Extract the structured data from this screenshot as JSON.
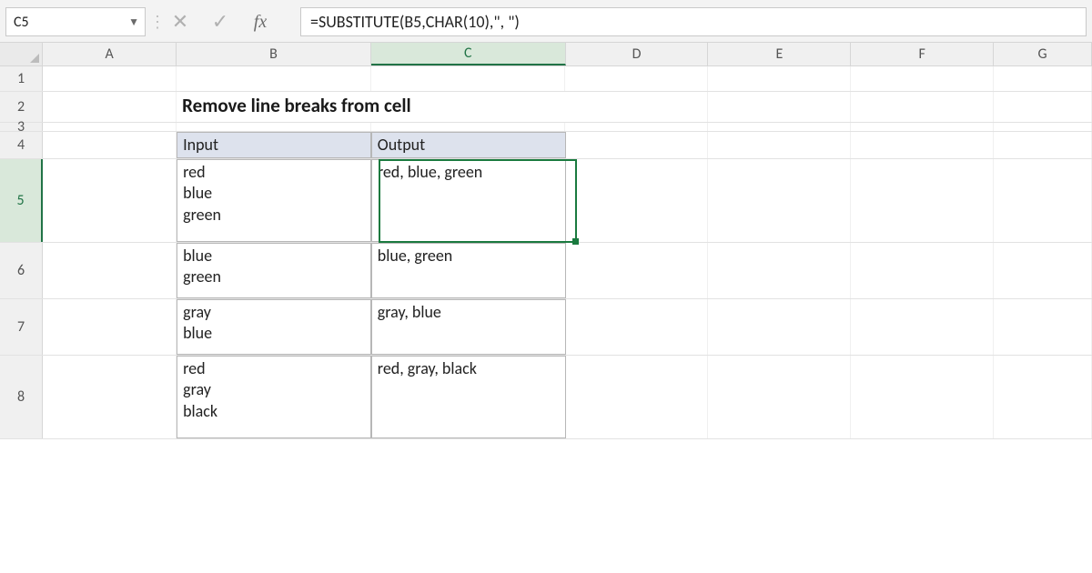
{
  "namebox": {
    "value": "C5"
  },
  "formula": "=SUBSTITUTE(B5,CHAR(10),\", \")",
  "fx_label": "fx",
  "columns": {
    "A": "A",
    "B": "B",
    "C": "C",
    "D": "D",
    "E": "E",
    "F": "F",
    "G": "G"
  },
  "rows": {
    "r1": "1",
    "r2": "2",
    "r3": "3",
    "r4": "4",
    "r5": "5",
    "r6": "6",
    "r7": "7",
    "r8": "8"
  },
  "title": "Remove line breaks from cell",
  "headers": {
    "input": "Input",
    "output": "Output"
  },
  "data": [
    {
      "input": "red\nblue\ngreen",
      "output": "red, blue, green"
    },
    {
      "input": "blue\ngreen",
      "output": "blue, green"
    },
    {
      "input": "gray\nblue",
      "output": "gray, blue"
    },
    {
      "input": "red\ngray\nblack",
      "output": "red, gray, black"
    }
  ],
  "active": {
    "cell": "C5",
    "col": "C",
    "row": "5"
  }
}
